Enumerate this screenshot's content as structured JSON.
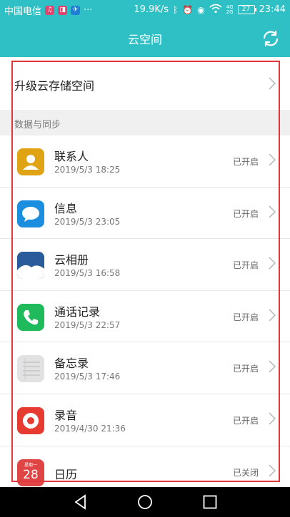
{
  "status_bar": {
    "carrier": "中国电信",
    "ellipsis": "···",
    "speed": "19.9K/s",
    "network_label": "4G",
    "network_label2": "2G",
    "battery": "27",
    "time": "23:44"
  },
  "title_bar": {
    "title": "云空间",
    "sync_icon": "sync-icon"
  },
  "upgrade": {
    "label": "升级云存储空间"
  },
  "section": {
    "label": "数据与同步"
  },
  "items": [
    {
      "name": "联系人",
      "time": "2019/5/3 18:25",
      "status": "已开启",
      "icon": "contacts-icon",
      "color": "#e0a313"
    },
    {
      "name": "信息",
      "time": "2019/5/3 23:05",
      "status": "已开启",
      "icon": "messages-icon",
      "color": "#1b8ee0"
    },
    {
      "name": "云相册",
      "time": "2019/5/3 16:58",
      "status": "已开启",
      "icon": "gallery-icon",
      "color": "#2a5b9a"
    },
    {
      "name": "通话记录",
      "time": "2019/5/3 22:57",
      "status": "已开启",
      "icon": "phone-icon",
      "color": "#1fba5c"
    },
    {
      "name": "备忘录",
      "time": "2019/5/3 17:46",
      "status": "已开启",
      "icon": "notes-icon",
      "color": "#dcdcdc"
    },
    {
      "name": "录音",
      "time": "2019/4/30 21:36",
      "status": "已开启",
      "icon": "recorder-icon",
      "color": "#e73a30"
    },
    {
      "name": "日历",
      "time": "",
      "status": "已关闭",
      "icon": "calendar-icon",
      "color": "#e04545",
      "calendar_weekday": "星期一",
      "calendar_day": "28"
    }
  ],
  "colors": {
    "header": "#2ec0c4",
    "highlight": "#e0373b"
  }
}
